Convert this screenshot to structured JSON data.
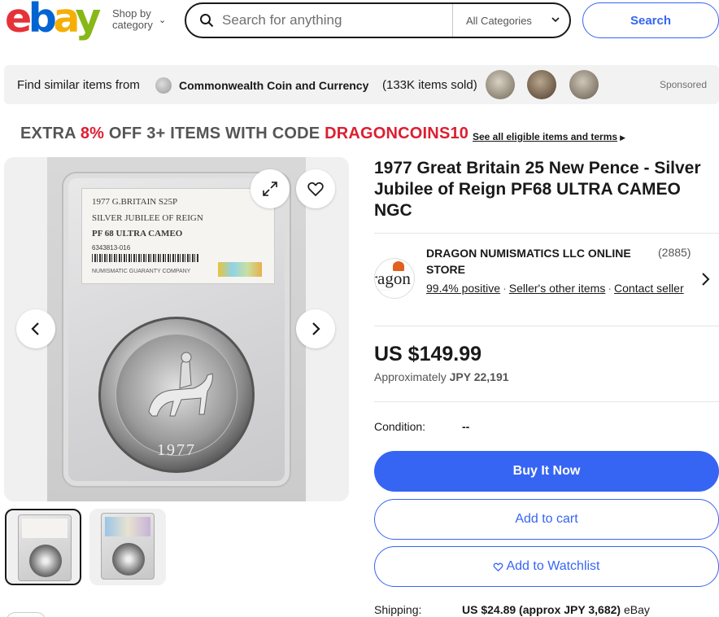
{
  "header": {
    "logo_letters": [
      "e",
      "b",
      "a",
      "y"
    ],
    "shop_by_line1": "Shop by",
    "shop_by_line2": "category",
    "search_placeholder": "Search for anything",
    "category_select": "All Categories",
    "search_button": "Search"
  },
  "similar_bar": {
    "label": "Find similar items from",
    "store_name": "Commonwealth Coin and Currency",
    "items_sold": "(133K items sold)",
    "sponsored": "Sponsored"
  },
  "promo": {
    "prefix": "EXTRA ",
    "percent": "8%",
    "middle": " OFF 3+ ITEMS WITH CODE ",
    "code": "DRAGONCOINS10",
    "link": "See all eligible items and terms"
  },
  "slab_label": {
    "line1": "1977 G.BRITAIN S25P",
    "line2": "SILVER JUBILEE OF REIGN",
    "line3": "PF 68 ULTRA CAMEO",
    "cert": "6343813-016",
    "company": "NUMISMATIC GUARANTY COMPANY",
    "year": "1977"
  },
  "item": {
    "title": "1977 Great Britain 25 New Pence - Silver Jubilee of Reign PF68 ULTRA CAMEO NGC"
  },
  "seller": {
    "logo_text": "ragon",
    "name": "DRAGON NUMISMATICS LLC ONLINE STORE",
    "feedback_count": "(2885)",
    "positive": "99.4% positive",
    "other_items": "Seller's other items",
    "contact": "Contact seller"
  },
  "pricing": {
    "price": "US $149.99",
    "approx_label": "Approximately",
    "approx_value": "JPY 22,191"
  },
  "condition": {
    "label": "Condition:",
    "value": "--"
  },
  "actions": {
    "buy_now": "Buy It Now",
    "add_to_cart": "Add to cart",
    "add_to_watchlist": "Add to Watchlist"
  },
  "shipping": {
    "label": "Shipping:",
    "value": "US $24.89 (approx JPY 3,682)",
    "carrier": "eBay"
  },
  "colors": {
    "accent_blue": "#3665f3",
    "promo_red": "#dd1e31",
    "text": "#191919"
  }
}
